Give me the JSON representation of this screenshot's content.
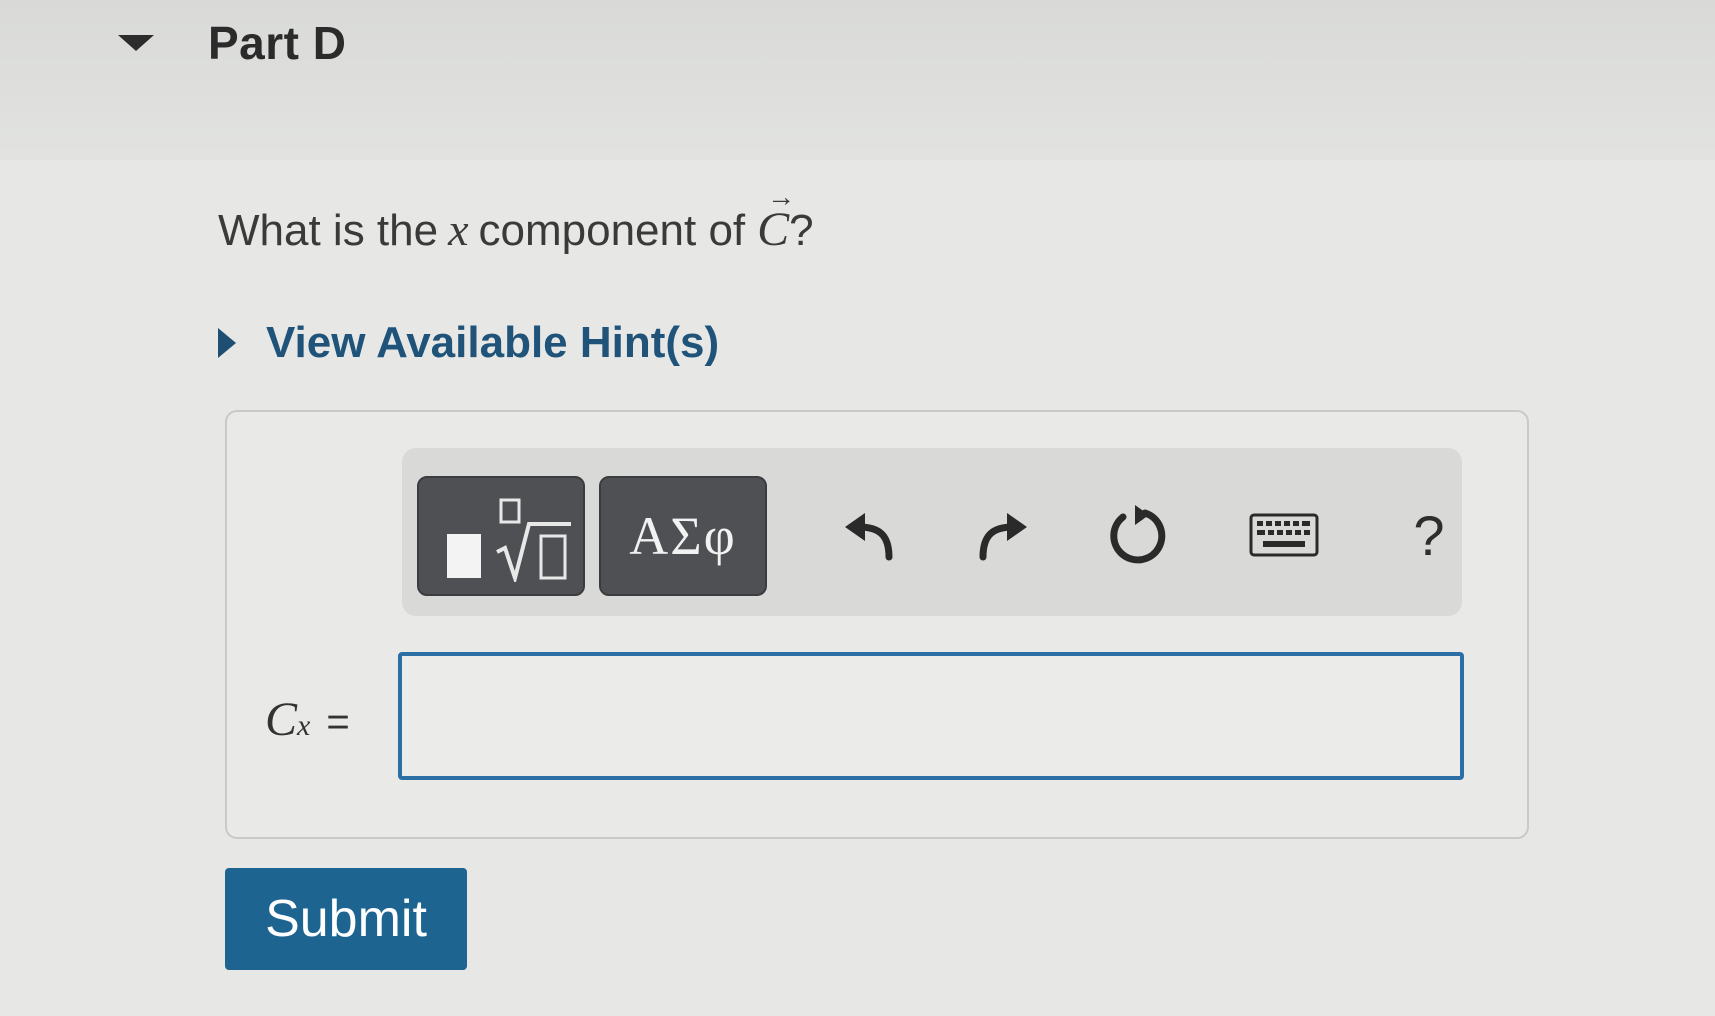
{
  "part": {
    "title": "Part D"
  },
  "question": {
    "prefix": "What is the",
    "variable": "x",
    "middle": "component of",
    "vector": "C",
    "suffix": "?"
  },
  "hints": {
    "label": "View Available Hint(s)"
  },
  "toolbar": {
    "templates_icon": "templates-icon",
    "symbols_label": "ΑΣφ",
    "undo_icon": "undo-icon",
    "redo_icon": "redo-icon",
    "reset_icon": "reset-icon",
    "keyboard_icon": "keyboard-icon",
    "help_label": "?"
  },
  "answer": {
    "label_var": "C",
    "label_sub": "x",
    "equals": "=",
    "value": ""
  },
  "submit": {
    "label": "Submit"
  },
  "colors": {
    "link": "#1f5379",
    "submit_bg": "#1d6590",
    "input_border": "#2b6fa5",
    "toolbar_button": "#4e5054"
  }
}
